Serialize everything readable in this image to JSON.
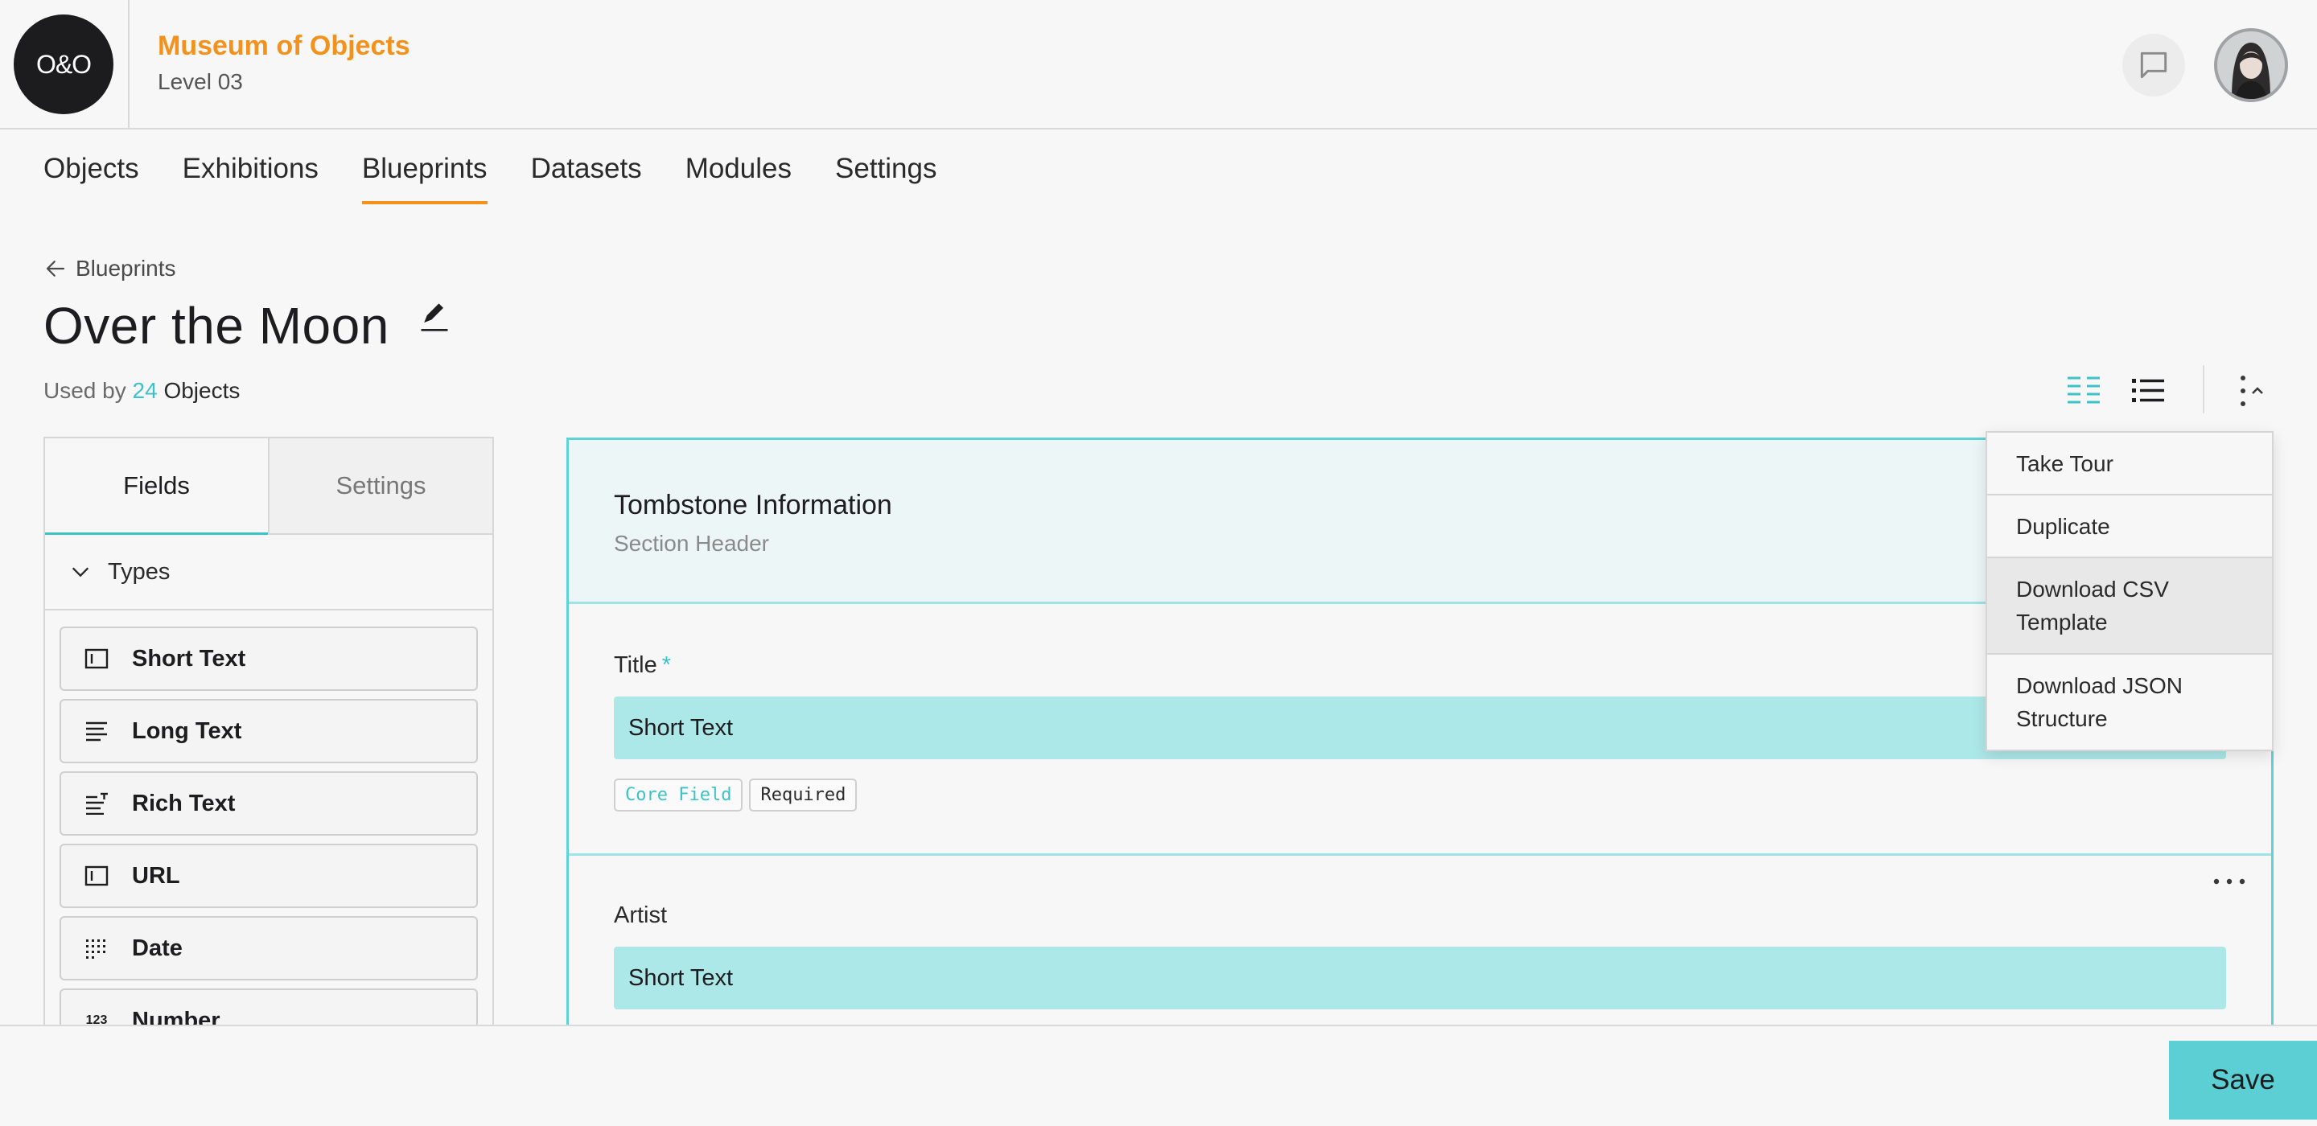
{
  "header": {
    "logo_text": "O&O",
    "org_name": "Museum of Objects",
    "org_level": "Level 03",
    "accent_color": "#f2921c"
  },
  "nav": {
    "items": [
      "Objects",
      "Exhibitions",
      "Blueprints",
      "Datasets",
      "Modules",
      "Settings"
    ],
    "active": "Blueprints"
  },
  "page": {
    "breadcrumb": "Blueprints",
    "title": "Over the Moon",
    "used_by_prefix": "Used by",
    "used_by_count": "24",
    "used_by_suffix": "Objects"
  },
  "left_panel": {
    "tabs": [
      "Fields",
      "Settings"
    ],
    "active_tab": "Fields",
    "group_label": "Types",
    "types": [
      {
        "label": "Short Text",
        "icon": "short-text-icon"
      },
      {
        "label": "Long Text",
        "icon": "long-text-icon"
      },
      {
        "label": "Rich Text",
        "icon": "rich-text-icon"
      },
      {
        "label": "URL",
        "icon": "url-icon"
      },
      {
        "label": "Date",
        "icon": "date-icon"
      },
      {
        "label": "Number",
        "icon": "number-icon"
      }
    ],
    "number_icon_glyph": "123"
  },
  "canvas": {
    "section_title": "Tombstone Information",
    "section_subtitle": "Section Header",
    "fields": [
      {
        "label": "Title",
        "required_mark": "*",
        "input_text": "Short Text",
        "badges": [
          "Core Field",
          "Required"
        ]
      },
      {
        "label": "Artist",
        "input_text": "Short Text"
      }
    ]
  },
  "dropdown": {
    "items": [
      "Take Tour",
      "Duplicate",
      "Download CSV Template",
      "Download JSON Structure"
    ],
    "hover_index": 2
  },
  "footer": {
    "save_label": "Save"
  },
  "colors": {
    "teal": "#3bc3c9",
    "teal_fill": "#ade8e9",
    "orange": "#f2921c"
  }
}
